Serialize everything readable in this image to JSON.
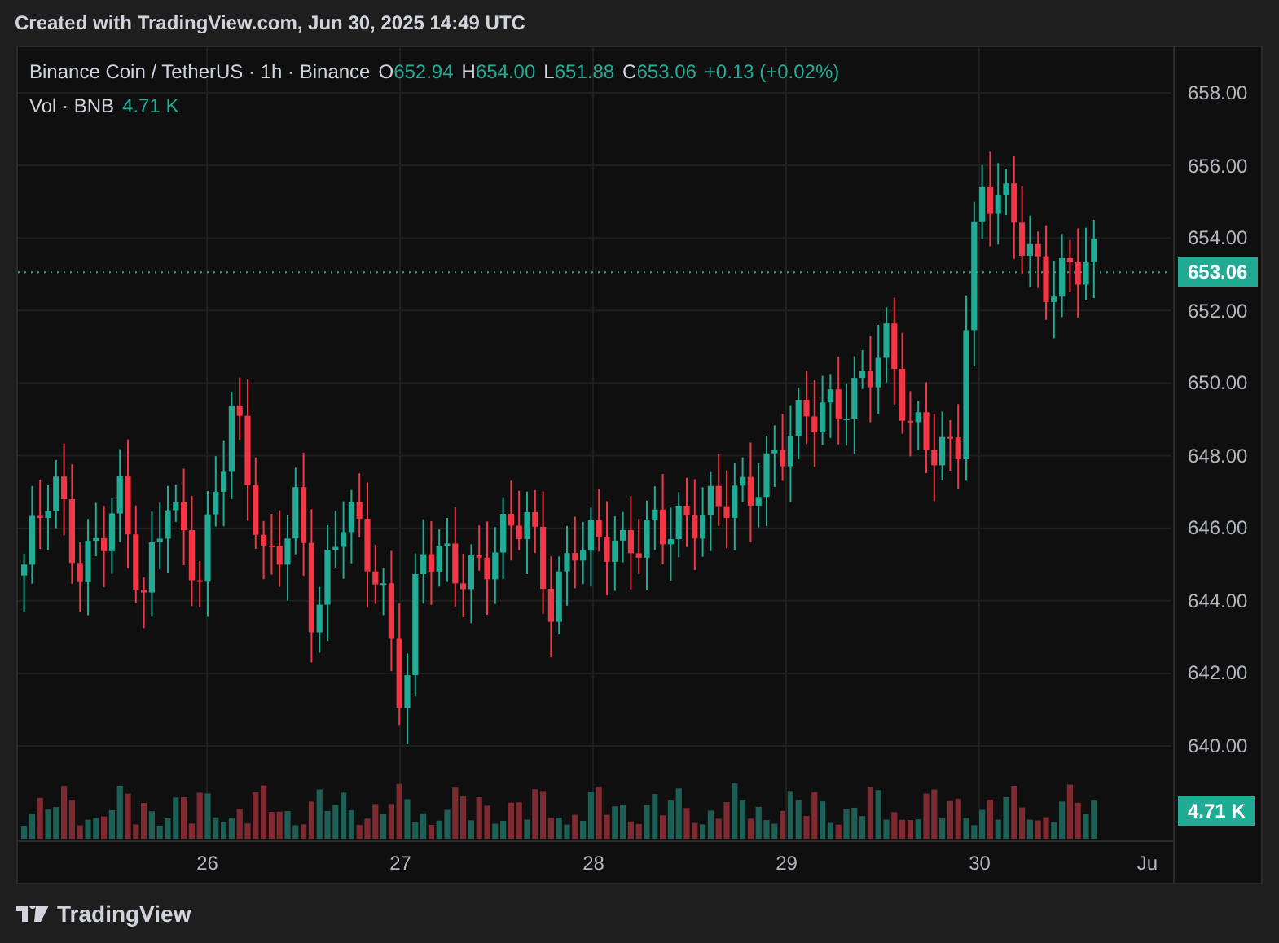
{
  "caption": "Created with TradingView.com, Jun 30, 2025 14:49 UTC",
  "legend": {
    "symbol": "Binance Coin / TetherUS · 1h · Binance",
    "ohlc": [
      {
        "key": "O",
        "value": "652.94"
      },
      {
        "key": "H",
        "value": "654.00"
      },
      {
        "key": "L",
        "value": "651.88"
      },
      {
        "key": "C",
        "value": "653.06"
      }
    ],
    "change": "+0.13 (+0.02%)",
    "volume_label": "Vol · BNB",
    "volume_value": "4.71 K"
  },
  "price_axis": {
    "ticks": [
      "658.00",
      "656.00",
      "654.00",
      "652.00",
      "650.00",
      "648.00",
      "646.00",
      "644.00",
      "642.00",
      "640.00"
    ],
    "last_price": "653.06",
    "last_volume": "4.71 K"
  },
  "time_axis": [
    "26",
    "27",
    "28",
    "29",
    "30",
    "Ju"
  ],
  "footer": {
    "logo_text": "TradingView"
  }
}
